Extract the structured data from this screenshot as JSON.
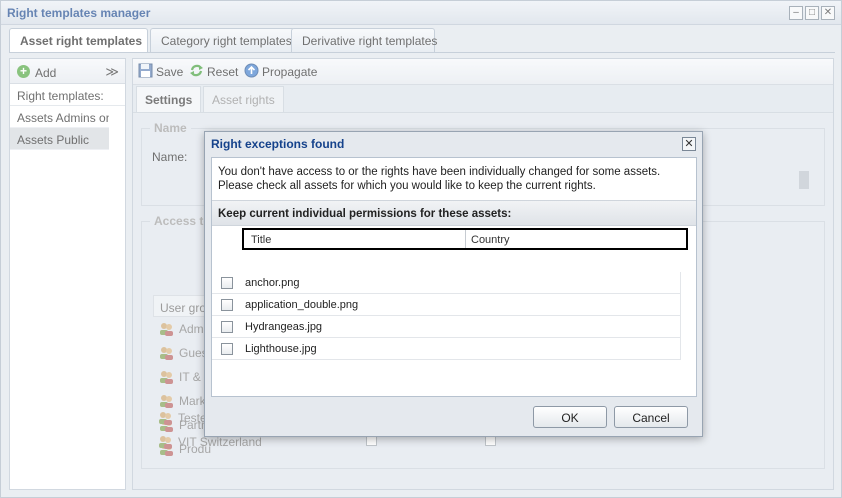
{
  "window": {
    "title": "Right templates manager"
  },
  "tabs": [
    "Asset right templates",
    "Category right templates",
    "Derivative right templates"
  ],
  "left": {
    "add_label": "Add",
    "collapse_glyph": "≫",
    "header": "Right templates:",
    "items": [
      "Assets Admins on",
      "Assets Public"
    ]
  },
  "toolbar": {
    "save": "Save",
    "reset": "Reset",
    "propagate": "Propagate"
  },
  "subtabs": [
    "Settings",
    "Asset rights"
  ],
  "settings": {
    "name_legend": "Name",
    "name_label": "Name:",
    "access_legend": "Access to",
    "grid_header": "User grou",
    "groups": [
      "Admi",
      "Guest",
      "IT & I",
      "Marke",
      "Partn",
      "Produ",
      "Teste",
      "VIT Switzerland"
    ]
  },
  "dialog": {
    "title": "Right exceptions found",
    "message": "You don't have access to or the rights have been individually changed for some assets. Please check all assets for which you would like to keep the current rights.",
    "section": "Keep current individual permissions for these assets:",
    "columns": [
      "Title",
      "Country"
    ],
    "rows": [
      "anchor.png",
      "application_double.png",
      "Hydrangeas.jpg",
      "Lighthouse.jpg"
    ],
    "ok": "OK",
    "cancel": "Cancel"
  },
  "colors": {
    "title_blue": "#15428b",
    "add_green": "#4aa33a"
  }
}
